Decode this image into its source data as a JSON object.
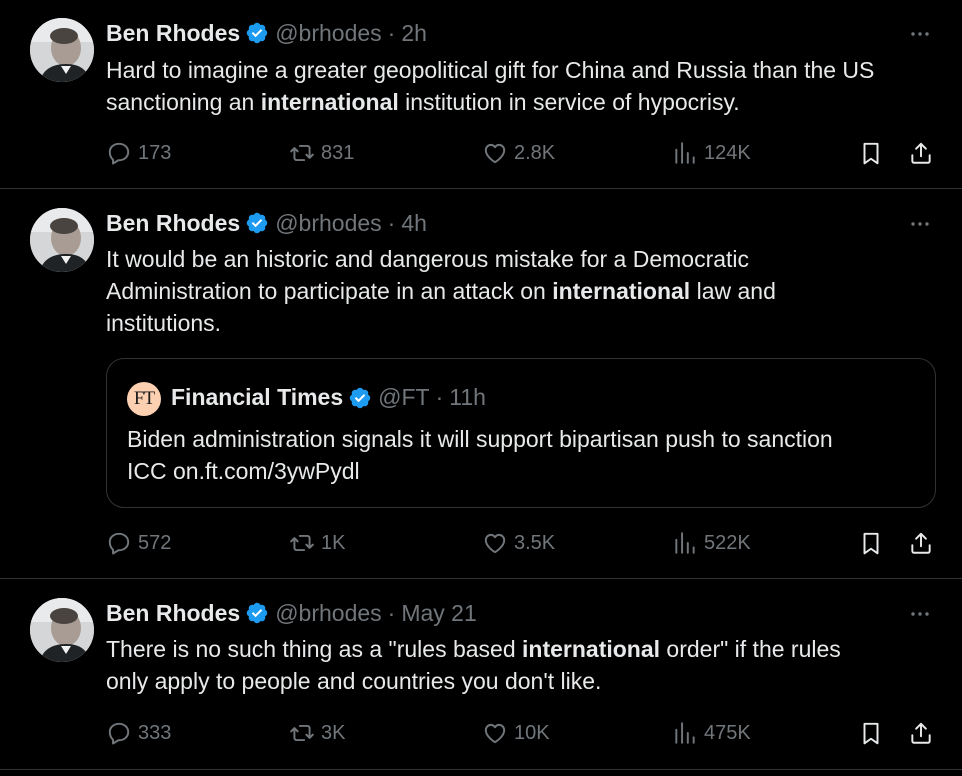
{
  "colors": {
    "background": "#000000",
    "text": "#e7e9ea",
    "muted": "#71767b",
    "verified": "#1d9bf0",
    "divider": "#2f3336",
    "ft_logo_bg": "#fcd0b1"
  },
  "tweets": [
    {
      "author": {
        "name": "Ben Rhodes",
        "handle": "@brhodes",
        "verified": true
      },
      "time": "2h",
      "text_parts": [
        "Hard to imagine a greater geopolitical gift for China and Russia than the US\nsanctioning an ",
        "international",
        " institution in service of hypocrisy."
      ],
      "stats": {
        "replies": "173",
        "retweets": "831",
        "likes": "2.8K",
        "views": "124K"
      }
    },
    {
      "author": {
        "name": "Ben Rhodes",
        "handle": "@brhodes",
        "verified": true
      },
      "time": "4h",
      "text_parts": [
        "It would be an historic and dangerous mistake for a Democratic\nAdministration to participate in an attack on ",
        "international",
        " law and\ninstitutions."
      ],
      "quote": {
        "logo_text": "FT",
        "author": {
          "name": "Financial Times",
          "handle": "@FT",
          "verified": true
        },
        "time": "11h",
        "text": "Biden administration signals it will support bipartisan push to sanction\nICC on.ft.com/3ywPydl"
      },
      "stats": {
        "replies": "572",
        "retweets": "1K",
        "likes": "3.5K",
        "views": "522K"
      }
    },
    {
      "author": {
        "name": "Ben Rhodes",
        "handle": "@brhodes",
        "verified": true
      },
      "time": "May 21",
      "text_parts": [
        "There is no such thing as a \"rules based ",
        "international",
        " order\" if the rules\nonly apply to people and countries you don't like."
      ],
      "stats": {
        "replies": "333",
        "retweets": "3K",
        "likes": "10K",
        "views": "475K"
      }
    }
  ],
  "dot_separator": "·",
  "icons": [
    "avatar",
    "verified-badge-icon",
    "more-icon",
    "reply-icon",
    "retweet-icon",
    "like-icon",
    "views-icon",
    "bookmark-icon",
    "share-icon"
  ]
}
